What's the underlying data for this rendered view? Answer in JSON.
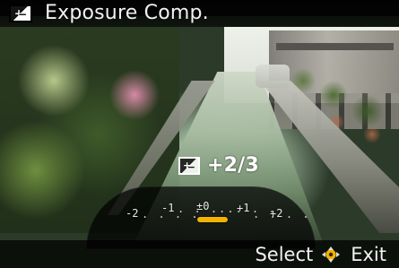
{
  "window": {
    "title": "Exposure Comp."
  },
  "overlay": {
    "exposure_value": "+2/3"
  },
  "dial": {
    "labels": [
      "-2",
      "-1",
      "±0",
      "+1",
      "+2"
    ],
    "dots": ". . . ."
  },
  "footer": {
    "select_label": "Select",
    "exit_label": "Exit"
  },
  "colors": {
    "accent": "#f2b400"
  }
}
